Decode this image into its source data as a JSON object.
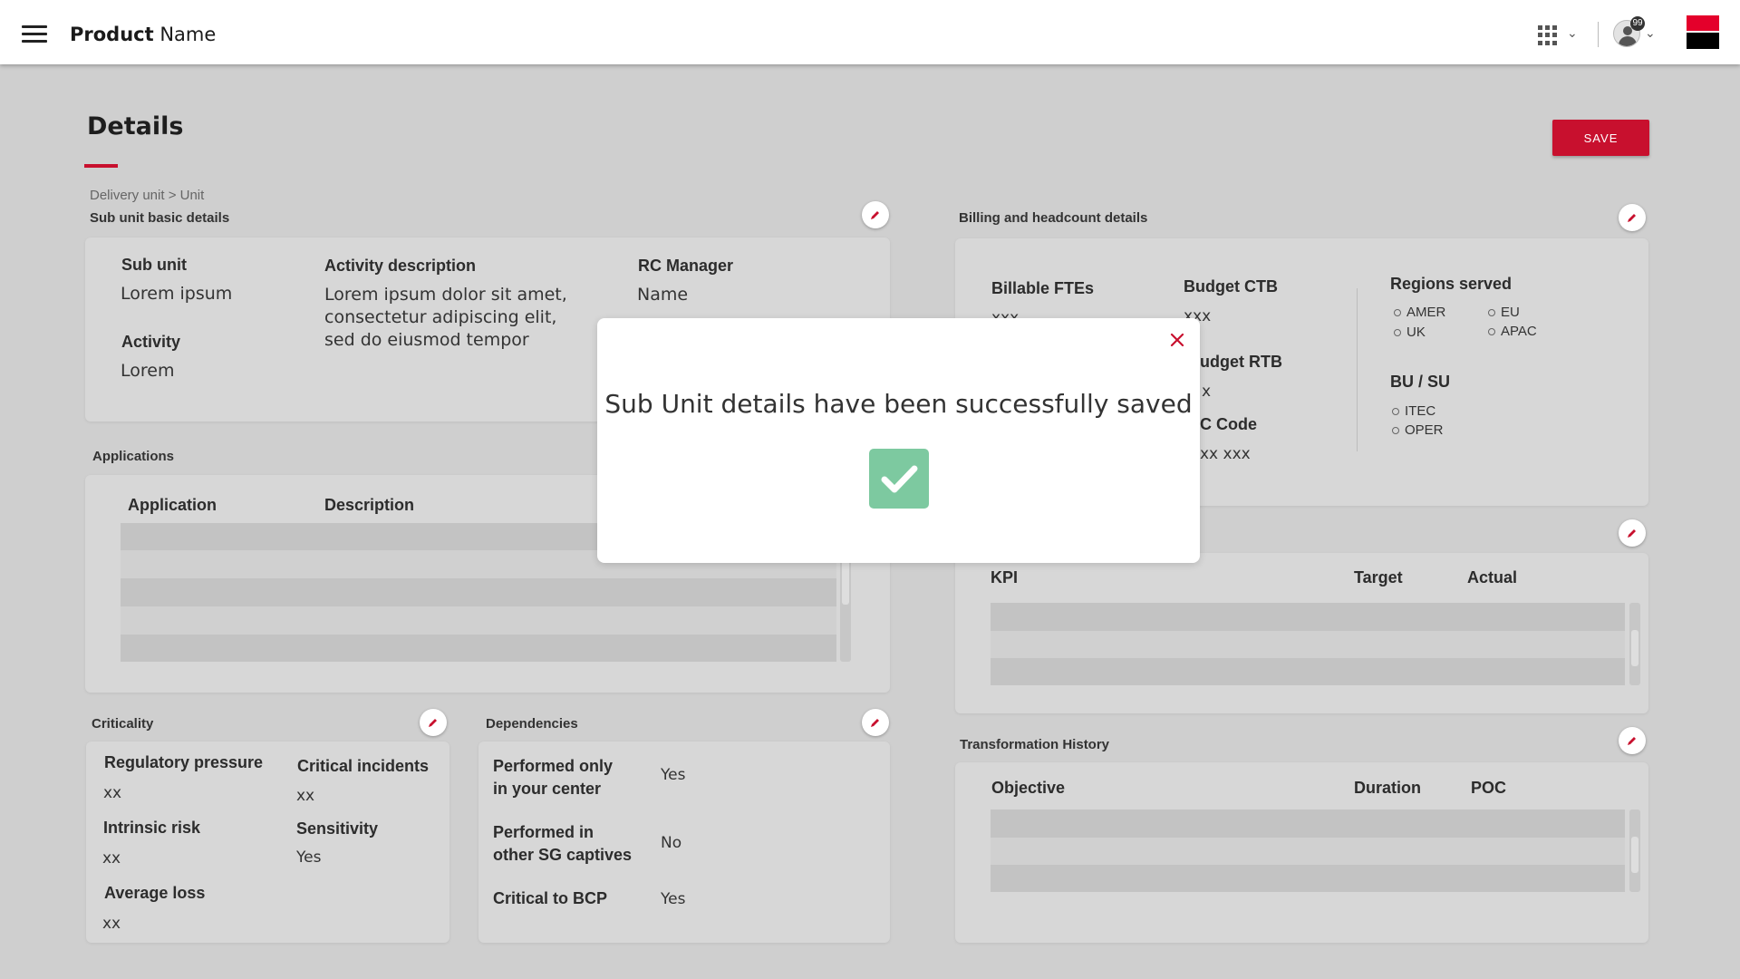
{
  "header": {
    "product_bold": "Product",
    "product_rest": " Name",
    "notification_count": "99",
    "icons": [
      "menu-icon",
      "apps-grid-icon",
      "chevron-down-icon",
      "user-avatar-icon",
      "brand-logo"
    ]
  },
  "page": {
    "title": "Details",
    "save_label": "SAVE",
    "breadcrumb": "Delivery unit > Unit"
  },
  "sub_unit": {
    "section_label": "Sub unit basic details",
    "sub_unit_label": "Sub unit",
    "sub_unit_value": "Lorem ipsum",
    "activity_label": "Activity",
    "activity_value": "Lorem",
    "activity_desc_label": "Activity description",
    "activity_desc_lines": [
      "Lorem ipsum dolor sit amet,",
      "consectetur adipiscing elit,",
      "sed do eiusmod tempor"
    ],
    "rc_manager_label": "RC Manager",
    "rc_manager_value": "Name"
  },
  "applications": {
    "section_label": "Applications",
    "col_application": "Application",
    "col_description": "Description"
  },
  "criticality": {
    "section_label": "Criticality",
    "regulatory_label": "Regulatory pressure",
    "regulatory_value": "xx",
    "critical_incidents_label": "Critical incidents",
    "critical_incidents_value": "xx",
    "intrinsic_label": "Intrinsic risk",
    "intrinsic_value": "xx",
    "sensitivity_label": "Sensitivity",
    "sensitivity_value": "Yes",
    "avg_loss_label": "Average loss",
    "avg_loss_value": "xx"
  },
  "dependencies": {
    "section_label": "Dependencies",
    "performed_center_label_1": "Performed only",
    "performed_center_label_2": "in your center",
    "performed_center_value": "Yes",
    "performed_other_label_1": "Performed in",
    "performed_other_label_2": "other SG captives",
    "performed_other_value": "No",
    "bcp_label": "Critical to BCP",
    "bcp_value": "Yes"
  },
  "billing": {
    "section_label": "Billing and headcount details",
    "billable_label": "Billable FTEs",
    "billable_value": "xxx",
    "budget_ctb_label": "Budget CTB",
    "budget_ctb_value": "xxx",
    "budget_rtb_label_partial": "udget RTB",
    "budget_rtb_value_partial": "x",
    "rc_code_label_partial": "C Code",
    "rc_code_value_partial": "xx xxx",
    "regions_label": "Regions served",
    "regions": [
      "AMER",
      "EU",
      "UK",
      "APAC"
    ],
    "bu_su_label": "BU / SU",
    "bu_su": [
      "ITEC",
      "OPER"
    ]
  },
  "kpi": {
    "col_kpi": "KPI",
    "col_target": "Target",
    "col_actual": "Actual"
  },
  "transformation": {
    "section_label": "Transformation History",
    "col_objective": "Objective",
    "col_duration": "Duration",
    "col_poc": "POC"
  },
  "modal": {
    "message": "Sub Unit details have been successfully saved"
  },
  "colors": {
    "accent": "#c8102e",
    "success": "#7dc9a0",
    "overlay_bg": "#cfcfcf"
  }
}
